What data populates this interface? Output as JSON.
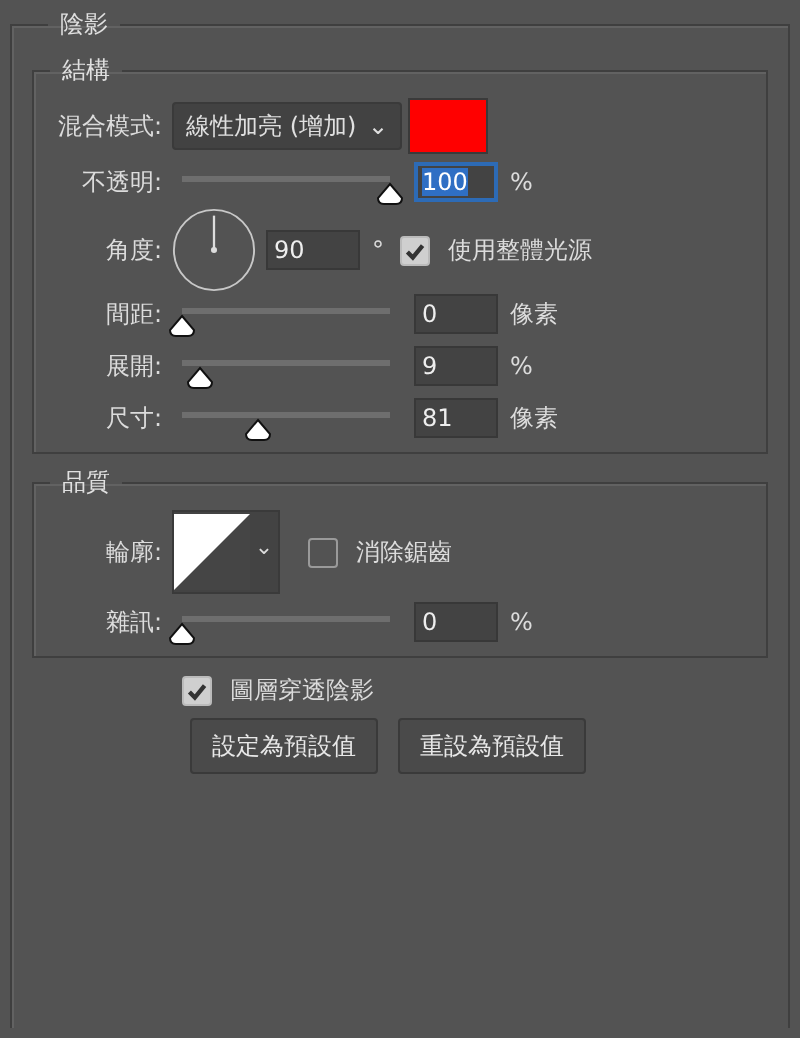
{
  "section_title": "陰影",
  "structure": {
    "title": "結構",
    "blend_mode": {
      "label": "混合模式:",
      "value": "線性加亮 (增加)",
      "caret": "⌄",
      "color": "#ff0000"
    },
    "opacity": {
      "label": "不透明:",
      "level": 1.0,
      "value": "100",
      "unit": "%",
      "focused": true
    },
    "angle": {
      "label": "角度:",
      "value": "90",
      "unit": "°",
      "global_light": {
        "label": "使用整體光源",
        "checked": true
      }
    },
    "sliders": [
      {
        "label": "間距:",
        "level": 0,
        "value": "0",
        "unit": "像素",
        "focused": false
      },
      {
        "label": "展開:",
        "level": 0.09,
        "value": "9",
        "unit": "%",
        "focused": false
      },
      {
        "label": "尺寸:",
        "level": 0.37,
        "value": "81",
        "unit": "像素",
        "focused": false
      }
    ]
  },
  "quality": {
    "title": "品質",
    "contour": {
      "label": "輪廓:",
      "caret": "⌄",
      "anti_alias": {
        "label": "消除鋸齒",
        "checked": false
      }
    },
    "noise": {
      "label": "雜訊:",
      "level": 0,
      "value": "0",
      "unit": "%",
      "focused": false
    }
  },
  "knockout": {
    "label": "圖層穿透陰影",
    "checked": true
  },
  "buttons": [
    "設定為預設值",
    "重設為預設值"
  ]
}
